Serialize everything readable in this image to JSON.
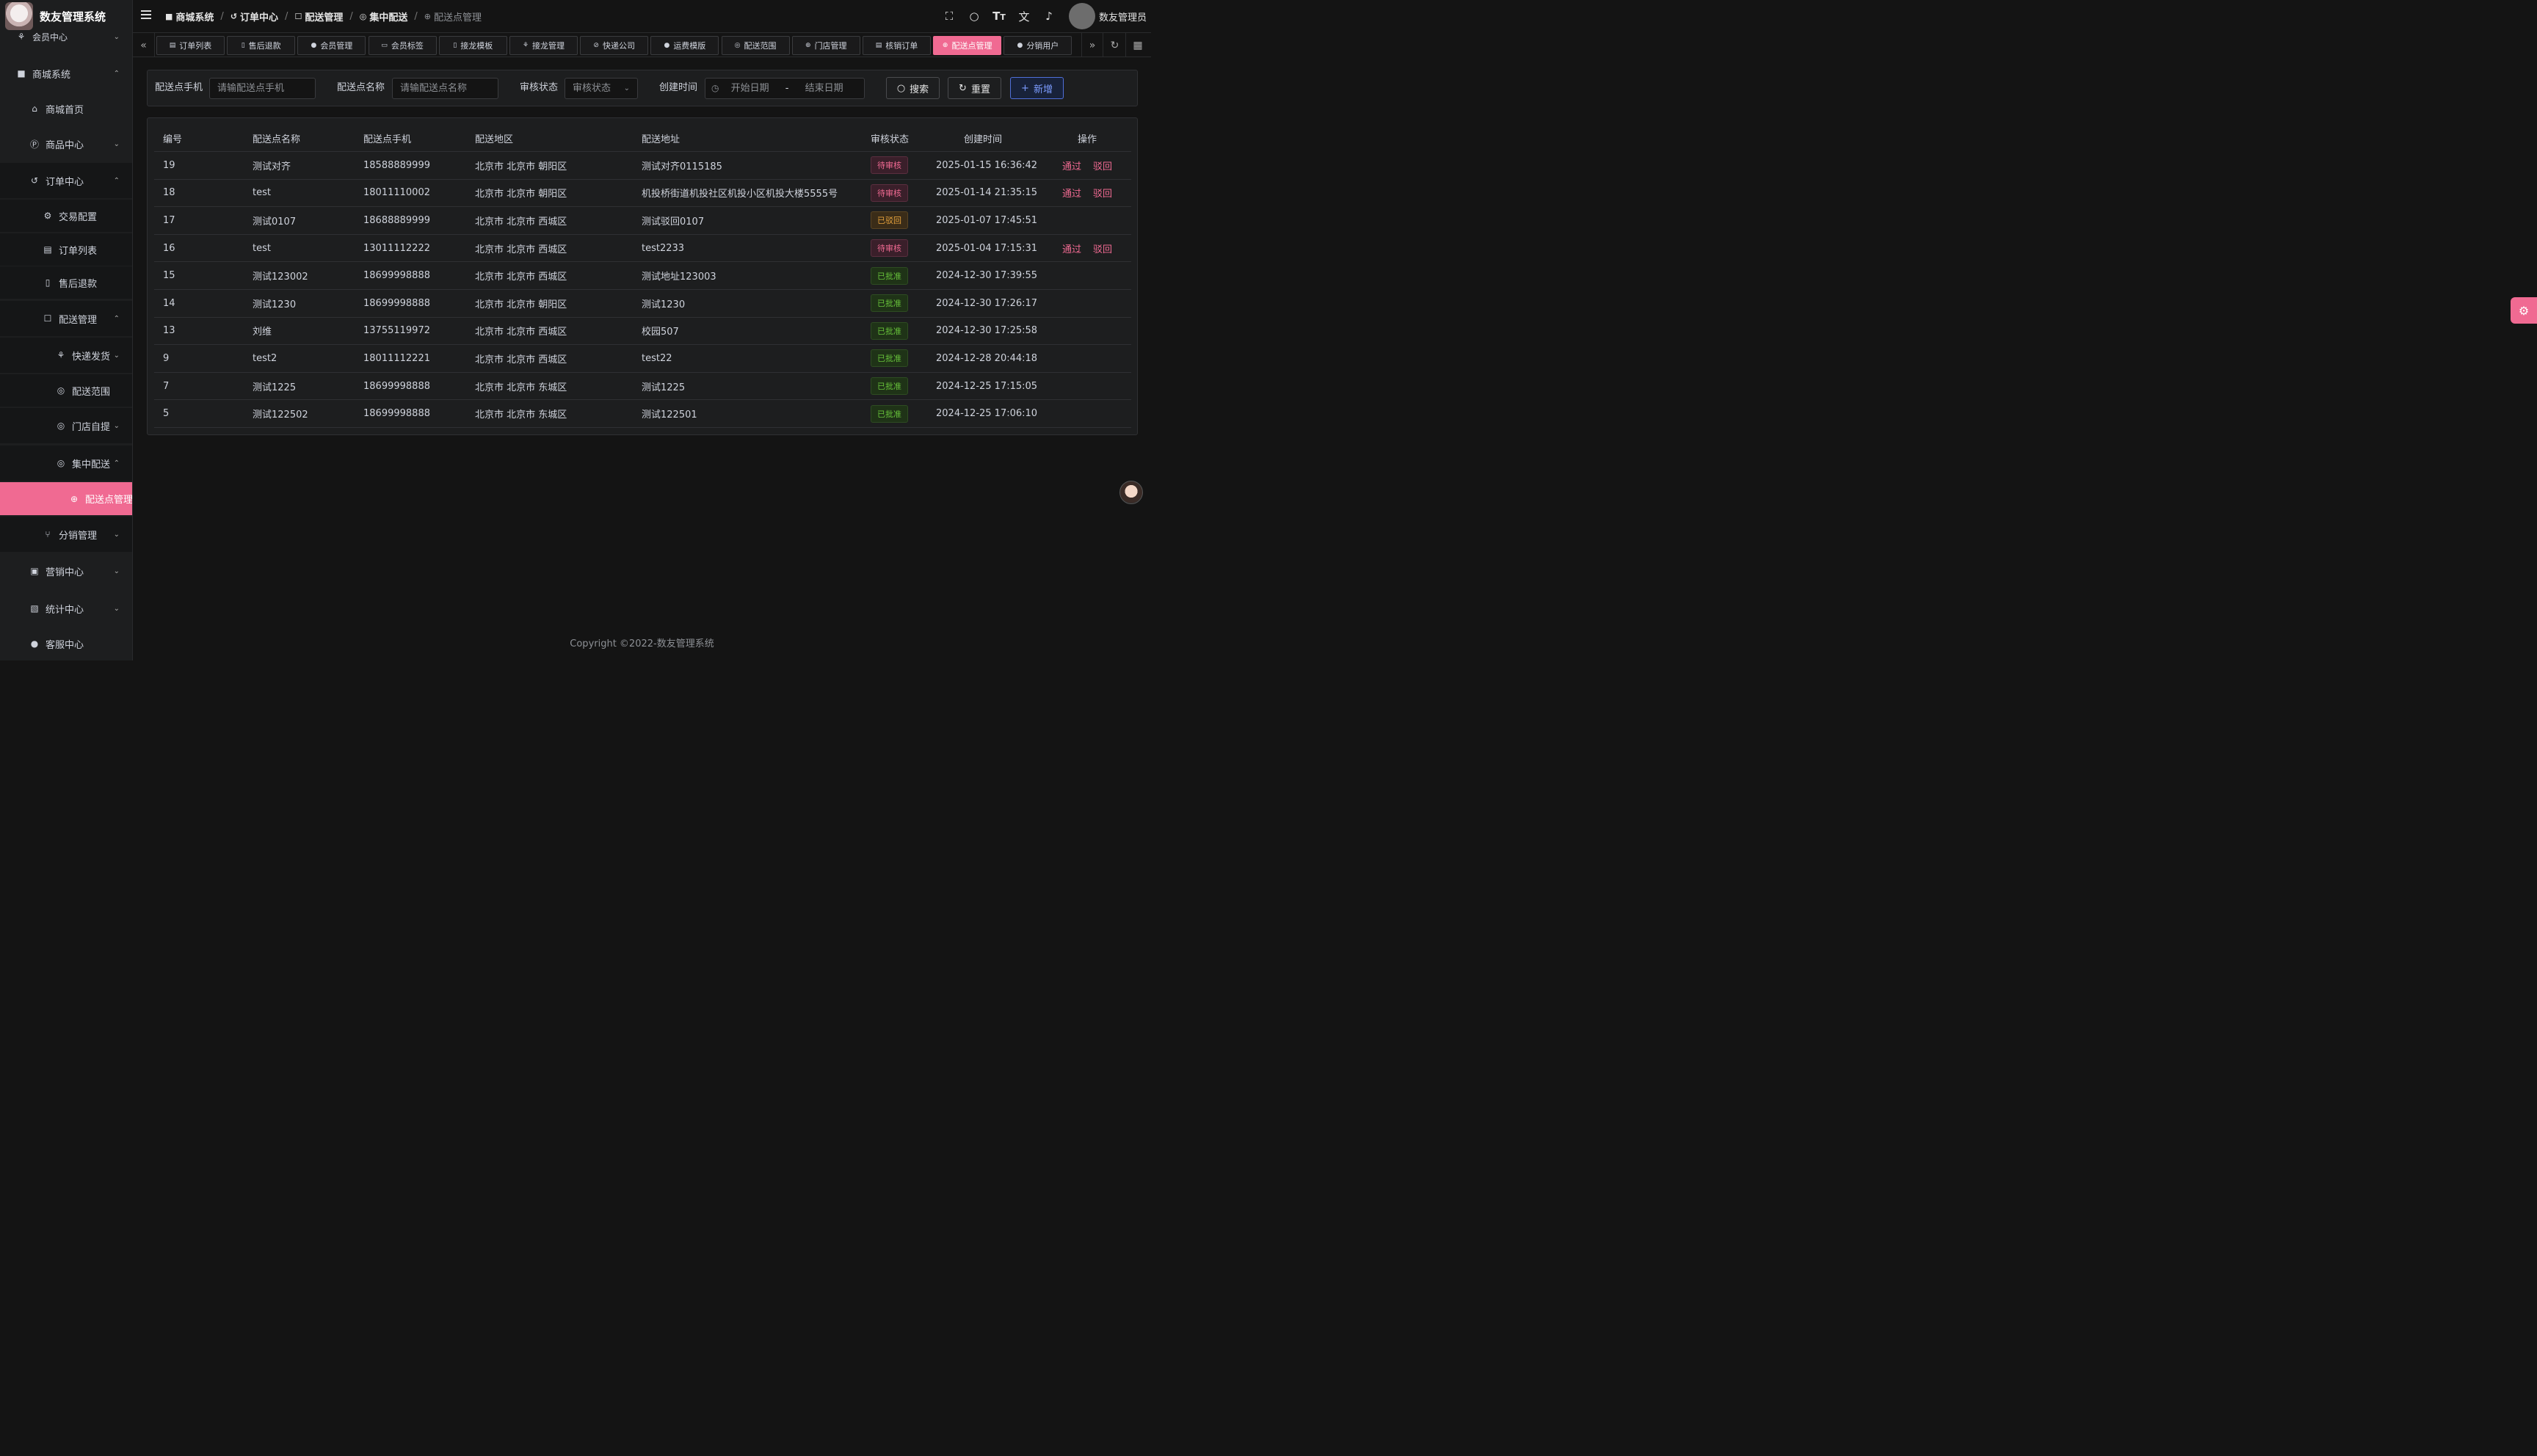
{
  "app": {
    "title": "数友管理系统"
  },
  "sidebar": {
    "partial_item": {
      "label": "会员中心",
      "icon": "bike-icon"
    },
    "items": [
      {
        "label": "商城系统",
        "icon": "shop-icon"
      },
      {
        "label": "商城首页",
        "icon": "home-icon"
      },
      {
        "label": "商品中心",
        "icon": "p-circle-icon"
      },
      {
        "label": "订单中心",
        "icon": "order-icon"
      },
      {
        "label": "交易配置",
        "icon": "gear-icon"
      },
      {
        "label": "订单列表",
        "icon": "clipboard-icon"
      },
      {
        "label": "售后退款",
        "icon": "document-icon"
      },
      {
        "label": "配送管理",
        "icon": "cart-icon"
      },
      {
        "label": "快递发货",
        "icon": "bike-icon"
      },
      {
        "label": "配送范围",
        "icon": "location-icon"
      },
      {
        "label": "门店自提",
        "icon": "location-icon"
      },
      {
        "label": "集中配送",
        "icon": "location-icon"
      },
      {
        "label": "配送点管理",
        "icon": "dribbble-icon"
      },
      {
        "label": "分销管理",
        "icon": "share-icon"
      },
      {
        "label": "营销中心",
        "icon": "gift-icon"
      },
      {
        "label": "统计中心",
        "icon": "chart-icon"
      },
      {
        "label": "客服中心",
        "icon": "user-icon"
      }
    ]
  },
  "header": {
    "breadcrumbs": [
      "商城系统",
      "订单中心",
      "配送管理",
      "集中配送",
      "配送点管理"
    ],
    "user_name": "数友管理员"
  },
  "tabs": [
    "订单列表",
    "售后退款",
    "会员管理",
    "会员标签",
    "接龙模板",
    "接龙管理",
    "快递公司",
    "运费模版",
    "配送范围",
    "门店管理",
    "核销订单",
    "配送点管理",
    "分销用户"
  ],
  "search": {
    "phone_label": "配送点手机",
    "phone_placeholder": "请输配送点手机",
    "name_label": "配送点名称",
    "name_placeholder": "请输配送点名称",
    "status_label": "审核状态",
    "status_placeholder": "审核状态",
    "time_label": "创建时间",
    "start_placeholder": "开始日期",
    "range_sep": "-",
    "end_placeholder": "结束日期",
    "search_btn": "搜索",
    "reset_btn": "重置",
    "add_btn": "新增"
  },
  "table": {
    "columns": [
      "编号",
      "配送点名称",
      "配送点手机",
      "配送地区",
      "配送地址",
      "审核状态",
      "创建时间",
      "操作"
    ],
    "actions": {
      "approve": "通过",
      "reject": "驳回"
    },
    "rows": [
      {
        "id": "19",
        "name": "测试对齐",
        "phone": "18588889999",
        "region": "北京市 北京市 朝阳区",
        "address": "测试对齐0115185",
        "status": "待审核",
        "created": "2025-01-15 16:36:42"
      },
      {
        "id": "18",
        "name": "test",
        "phone": "18011110002",
        "region": "北京市 北京市 朝阳区",
        "address": "机投桥街道机投社区机投小区机投大楼5555号",
        "status": "待审核",
        "created": "2025-01-14 21:35:15"
      },
      {
        "id": "17",
        "name": "测试0107",
        "phone": "18688889999",
        "region": "北京市 北京市 西城区",
        "address": "测试驳回0107",
        "status": "已驳回",
        "created": "2025-01-07 17:45:51"
      },
      {
        "id": "16",
        "name": "test",
        "phone": "13011112222",
        "region": "北京市 北京市 西城区",
        "address": "test2233",
        "status": "待审核",
        "created": "2025-01-04 17:15:31"
      },
      {
        "id": "15",
        "name": "测试123002",
        "phone": "18699998888",
        "region": "北京市 北京市 西城区",
        "address": "测试地址123003",
        "status": "已批准",
        "created": "2024-12-30 17:39:55"
      },
      {
        "id": "14",
        "name": "测试1230",
        "phone": "18699998888",
        "region": "北京市 北京市 朝阳区",
        "address": "测试1230",
        "status": "已批准",
        "created": "2024-12-30 17:26:17"
      },
      {
        "id": "13",
        "name": "刘维",
        "phone": "13755119972",
        "region": "北京市 北京市 西城区",
        "address": "校园507",
        "status": "已批准",
        "created": "2024-12-30 17:25:58"
      },
      {
        "id": "9",
        "name": "test2",
        "phone": "18011112221",
        "region": "北京市 北京市 西城区",
        "address": "test22",
        "status": "已批准",
        "created": "2024-12-28 20:44:18"
      },
      {
        "id": "7",
        "name": "测试1225",
        "phone": "18699998888",
        "region": "北京市 北京市 东城区",
        "address": "测试1225",
        "status": "已批准",
        "created": "2024-12-25 17:15:05"
      },
      {
        "id": "5",
        "name": "测试122502",
        "phone": "18699998888",
        "region": "北京市 北京市 东城区",
        "address": "测试122501",
        "status": "已批准",
        "created": "2024-12-25 17:06:10"
      }
    ]
  },
  "footer": {
    "copyright": "Copyright ©2022-数友管理系统"
  },
  "colors": {
    "accent": "#f06a92",
    "primary": "#4f6fd8",
    "approved": "#67c23a",
    "rejected": "#e6a23c"
  }
}
